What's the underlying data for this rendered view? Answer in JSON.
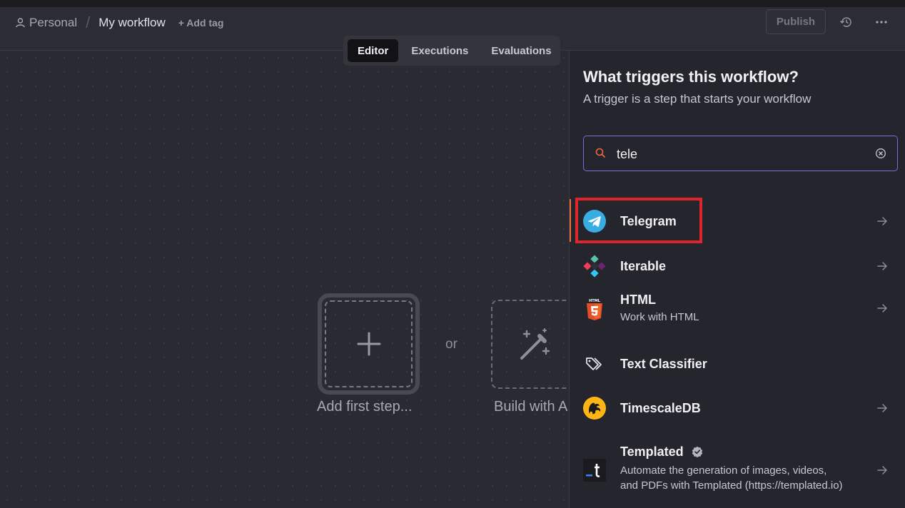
{
  "header": {
    "project": "Personal",
    "separator": "/",
    "workflow_name": "My workflow",
    "add_tag": "+ Add tag",
    "publish": "Publish"
  },
  "tabs": [
    {
      "label": "Editor",
      "active": true
    },
    {
      "label": "Executions",
      "active": false
    },
    {
      "label": "Evaluations",
      "active": false
    }
  ],
  "canvas": {
    "add_first_step": "Add first step...",
    "or": "or",
    "build_with_ai": "Build with AI"
  },
  "panel": {
    "title": "What triggers this workflow?",
    "subtitle": "A trigger is a step that starts your workflow",
    "search_value": "tele",
    "items": [
      {
        "name": "Telegram",
        "icon": "telegram-icon",
        "highlighted": true
      },
      {
        "name": "Iterable",
        "icon": "iterable-icon"
      },
      {
        "name": "HTML",
        "desc": "Work with HTML",
        "icon": "html5-icon"
      },
      {
        "name": "Text Classifier",
        "icon": "tag-icon"
      },
      {
        "name": "TimescaleDB",
        "icon": "timescaledb-icon"
      },
      {
        "name": "Templated",
        "desc_line1": "Automate the generation of images, videos,",
        "desc_line2": "and PDFs with Templated (https://templated.io)",
        "icon": "templated-icon",
        "verified": true
      }
    ]
  },
  "colors": {
    "accent": "#ee6b3c",
    "search_border": "#7c6fd6",
    "highlight_box": "#e0242c",
    "telegram": "#37aee2",
    "timescale": "#fdb515",
    "html5": "#e44d26"
  }
}
